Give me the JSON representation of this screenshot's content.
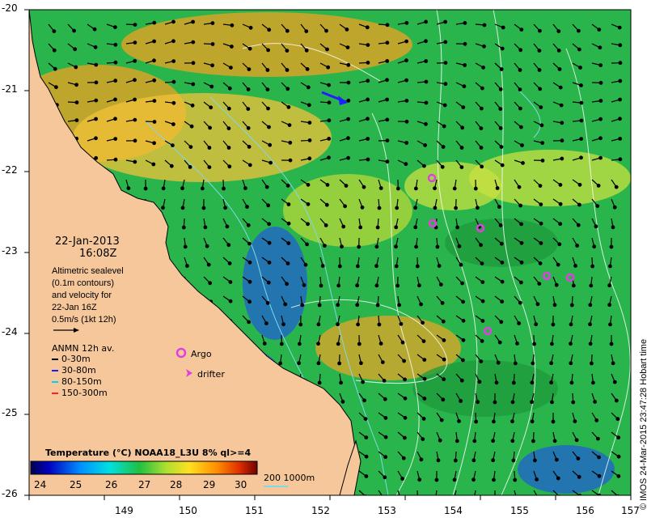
{
  "map": {
    "lon_ticks": [
      "149",
      "150",
      "151",
      "152",
      "153",
      "154",
      "155",
      "156",
      "157"
    ],
    "lat_ticks": [
      "-20",
      "-21",
      "-22",
      "-23",
      "-24",
      "-25",
      "-26"
    ],
    "lon_range": [
      149,
      157
    ],
    "lat_range": [
      -26,
      -20
    ],
    "colors": {
      "land": "#f6c79b",
      "ocean_mid": "#27b84a",
      "ocean_warm": "#f0a020",
      "ocean_cool": "#2060d0",
      "contour": "#ffffff",
      "isobath": "#7fd8e6"
    }
  },
  "annotations": {
    "date": "22-Jan-2013",
    "time": "16:08Z",
    "altimetry_lines": [
      "Altimetric sealevel",
      "(0.1m contours)",
      "and velocity for",
      "22-Jan 16Z"
    ],
    "scale_label": "0.5m/s (1kt 12h)",
    "anmn_title": "ANMN 12h av.",
    "anmn_depths": [
      {
        "label": "0-30m",
        "color": "#000000"
      },
      {
        "label": "30-80m",
        "color": "#1a1aff"
      },
      {
        "label": "80-150m",
        "color": "#00d0ff"
      },
      {
        "label": "150-300m",
        "color": "#ff2020"
      }
    ],
    "argo_label": "Argo",
    "drifter_label": "drifter",
    "argo_color": "#e040e0"
  },
  "colorbar": {
    "title": "Temperature (°C) NOAA18_L3U 8% ql>=4",
    "ticks": [
      "24",
      "25",
      "26",
      "27",
      "28",
      "29",
      "30"
    ]
  },
  "contour_legend": "200  1000m",
  "credit": "© IMOS 24-Mar-2015 23:47:28 Hobart time"
}
